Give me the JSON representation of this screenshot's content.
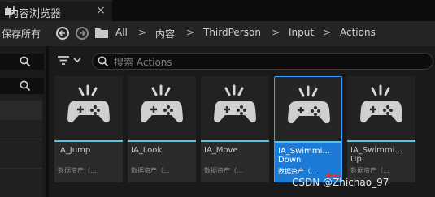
{
  "tab": {
    "title": "内容浏览器",
    "close_glyph": "×",
    "icon": "content-browser-icon"
  },
  "toolbar": {
    "save_all": "保存所有",
    "breadcrumbs": [
      "All",
      "内容",
      "ThirdPerson",
      "Input",
      "Actions"
    ],
    "separator": ">"
  },
  "search": {
    "placeholder": "搜索 Actions"
  },
  "accent": {
    "selected": "#1c7bd6",
    "asset_bar": "#5fc2d8"
  },
  "assets": [
    {
      "name": "IA_Jump",
      "name2": "",
      "type": "数据资产（...",
      "selected": false
    },
    {
      "name": "IA_Look",
      "name2": "",
      "type": "数据资产（...",
      "selected": false
    },
    {
      "name": "IA_Move",
      "name2": "",
      "type": "数据资产（...",
      "selected": false
    },
    {
      "name": "IA_Swimmi...",
      "name2": "Down",
      "type": "数据资产（...",
      "selected": true
    },
    {
      "name": "IA_Swimmi...",
      "name2": "Up",
      "type": "数据资产（...",
      "selected": false
    }
  ],
  "watermark": "CSDN @Zhichao_97"
}
